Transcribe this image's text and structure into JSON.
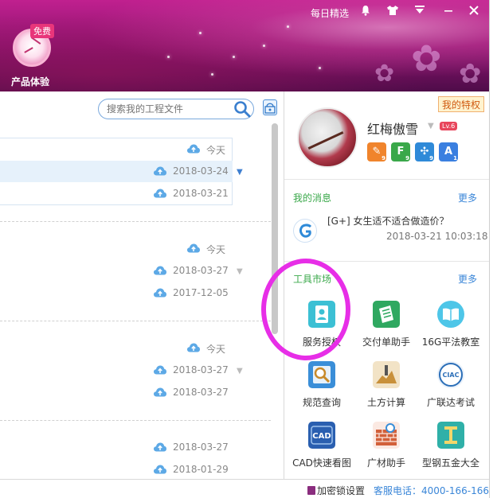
{
  "header": {
    "free_badge": "免费",
    "product_label": "产品体验",
    "daily_pick": "每日精选"
  },
  "search": {
    "placeholder": "搜索我的工程文件"
  },
  "file_groups": [
    {
      "rows": [
        {
          "date": "今天"
        },
        {
          "date": "2018-03-24"
        },
        {
          "date": "2018-03-21"
        }
      ]
    },
    {
      "rows": [
        {
          "date": "今天"
        },
        {
          "date": "2018-03-27"
        },
        {
          "date": "2017-12-05"
        }
      ]
    },
    {
      "rows": [
        {
          "date": "今天"
        },
        {
          "date": "2018-03-27"
        },
        {
          "date": "2018-03-27"
        }
      ]
    },
    {
      "rows": [
        {
          "date": "2018-03-27"
        },
        {
          "date": "2018-01-29"
        }
      ]
    }
  ],
  "profile": {
    "privilege_tag": "我的特权",
    "username": "红梅傲雪",
    "level": "Lv.6",
    "badges": [
      {
        "glyph": "✎",
        "sub": "9",
        "color": "#f0842c"
      },
      {
        "glyph": "F",
        "sub": "9",
        "color": "#3aa84a"
      },
      {
        "glyph": "✣",
        "sub": "9",
        "color": "#2f8ad8"
      },
      {
        "glyph": "A",
        "sub": "1",
        "color": "#3a7fe0"
      }
    ]
  },
  "messages": {
    "title": "我的消息",
    "more": "更多",
    "item_text": "[G+] 女生适不适合做造价？",
    "item_time": "2018-03-21 10:03:18"
  },
  "tools": {
    "title": "工具市场",
    "more": "更多",
    "items": [
      {
        "label": "服务授权",
        "icon": "user-badge-icon",
        "color": "#3cc0d4"
      },
      {
        "label": "交付单助手",
        "icon": "document-list-icon",
        "color": "#2fa860"
      },
      {
        "label": "16G平法教室",
        "icon": "open-book-icon",
        "color": "#4ec6e8"
      },
      {
        "label": "规范查询",
        "icon": "magnifier-doc-icon",
        "color": "#3a8ed8"
      },
      {
        "label": "土方计算",
        "icon": "earthwork-icon",
        "color": "#c8903a"
      },
      {
        "label": "广联达考试",
        "icon": "ciac-logo-icon",
        "color": "#2c6fb8"
      },
      {
        "label": "CAD快速看图",
        "icon": "cad-icon",
        "color": "#2a5fb0"
      },
      {
        "label": "广材助手",
        "icon": "brick-wall-icon",
        "color": "#d2603a"
      },
      {
        "label": "型钢五金大全",
        "icon": "steel-beam-icon",
        "color": "#2fb0a8"
      }
    ]
  },
  "footer": {
    "lock_setting": "加密锁设置",
    "hotline": "客服电话：4000-166-166"
  }
}
